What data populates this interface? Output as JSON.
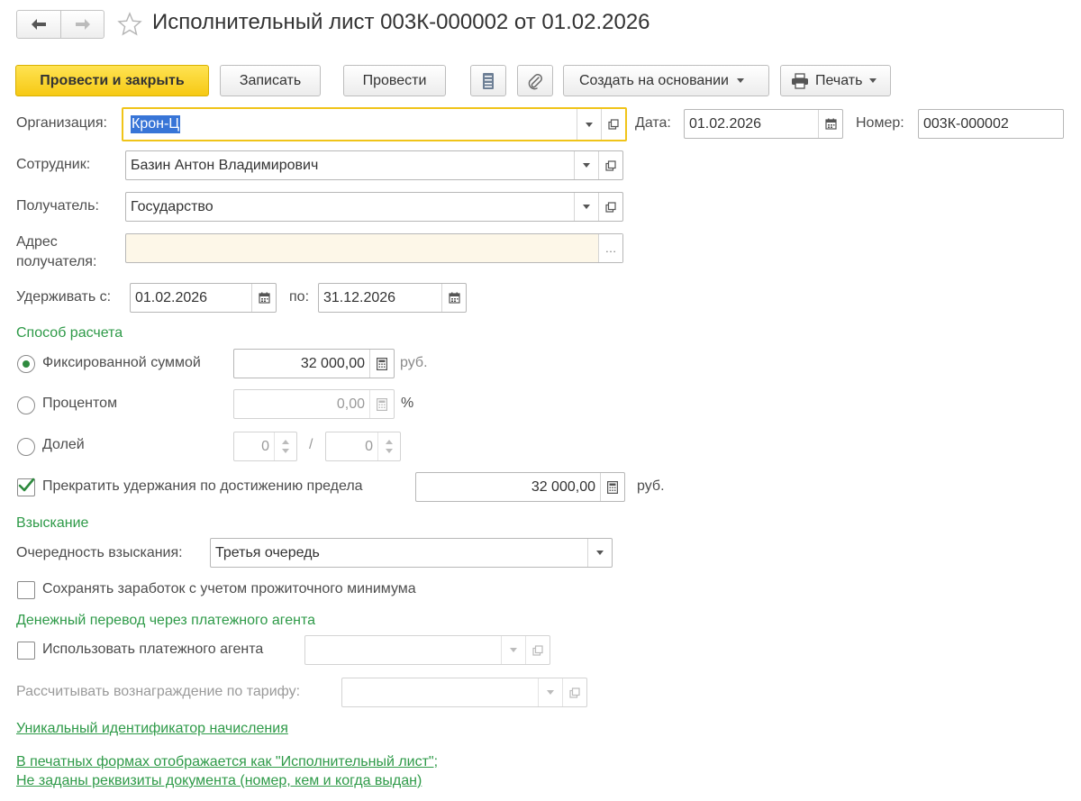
{
  "header": {
    "title": "Исполнительный лист 003К-000002 от 01.02.2026",
    "back_icon": "arrow-left-icon",
    "forward_icon": "arrow-right-icon",
    "favorite_icon": "star-icon"
  },
  "toolbar": {
    "post_close_label": "Провести и закрыть",
    "save_label": "Записать",
    "post_label": "Провести",
    "create_based_label": "Создать на основании",
    "print_label": "Печать"
  },
  "org": {
    "label": "Организация:",
    "value": "Крон-Ц"
  },
  "date": {
    "label": "Дата:",
    "value": "01.02.2026"
  },
  "number": {
    "label": "Номер:",
    "value": "003К-000002"
  },
  "employee": {
    "label": "Сотрудник:",
    "value": "Базин Антон Владимирович"
  },
  "recipient": {
    "label": "Получатель:",
    "value": "Государство"
  },
  "recipient_address": {
    "label_line1": "Адрес",
    "label_line2": "получателя:",
    "value": ""
  },
  "withhold": {
    "from_label": "Удерживать с:",
    "from_value": "01.02.2026",
    "to_label": "по:",
    "to_value": "31.12.2026"
  },
  "calc_method": {
    "section_title": "Способ расчета",
    "fixed": {
      "label": "Фиксированной суммой",
      "value": "32 000,00",
      "unit": "руб.",
      "selected": true
    },
    "percent": {
      "label": "Процентом",
      "value": "0,00",
      "unit": "%",
      "selected": false
    },
    "shares": {
      "label": "Долей",
      "numerator": "0",
      "separator": "/",
      "denominator": "0",
      "selected": false
    }
  },
  "limit": {
    "label": "Прекратить удержания по достижению предела",
    "checked": true,
    "value": "32 000,00",
    "unit": "руб."
  },
  "collection": {
    "section_title": "Взыскание",
    "priority_label": "Очередность взыскания:",
    "priority_value": "Третья очередь",
    "keep_minimum_label": "Сохранять заработок с учетом прожиточного минимума",
    "keep_minimum_checked": false
  },
  "payment_agent": {
    "section_title": "Денежный перевод через платежного агента",
    "use_label": "Использовать платежного агента",
    "use_checked": false,
    "use_value": "",
    "tariff_label": "Рассчитывать вознаграждение по тарифу:",
    "tariff_value": ""
  },
  "links": {
    "accrual_id": "Уникальный идентификатор начисления",
    "print_forms_line1": "В печатных формах отображается как \"Исполнительный лист\";",
    "print_forms_line2": "Не заданы реквизиты документа (номер, кем и когда выдан)"
  },
  "colors": {
    "accent_green": "#2e9a48",
    "primary_yellow": "#f6c914",
    "focus_border": "#f0c419",
    "selection_blue": "#3875d7",
    "address_bg": "#fdf7e8"
  }
}
